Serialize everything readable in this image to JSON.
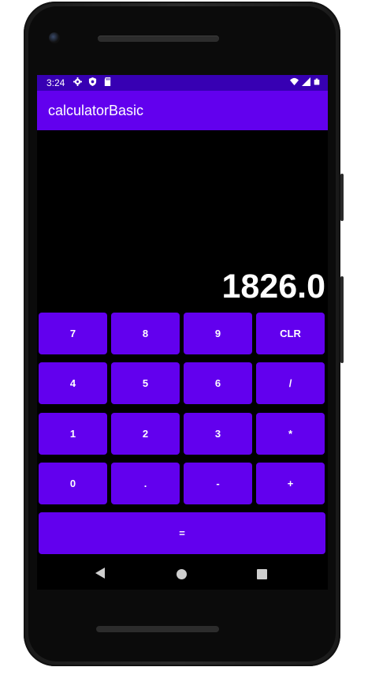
{
  "status_bar": {
    "time": "3:24",
    "left_icons": [
      "settings-icon",
      "shield-icon",
      "sd-card-icon"
    ],
    "right_icons": [
      "wifi-icon",
      "signal-icon",
      "battery-icon"
    ]
  },
  "app_bar": {
    "title": "calculatorBasic"
  },
  "display": {
    "value": "1826.0"
  },
  "keypad": {
    "row1": [
      "7",
      "8",
      "9",
      "CLR"
    ],
    "row2": [
      "4",
      "5",
      "6",
      "/"
    ],
    "row3": [
      "1",
      "2",
      "3",
      "*"
    ],
    "row4": [
      "0",
      ".",
      "-",
      "+"
    ],
    "equals": "="
  },
  "colors": {
    "status_bar": "#3700b3",
    "app_bar": "#6200ee",
    "key": "#6200ee",
    "screen_bg": "#000000"
  },
  "nav_bar": {
    "icons": [
      "back-icon",
      "home-icon",
      "recents-icon"
    ]
  }
}
